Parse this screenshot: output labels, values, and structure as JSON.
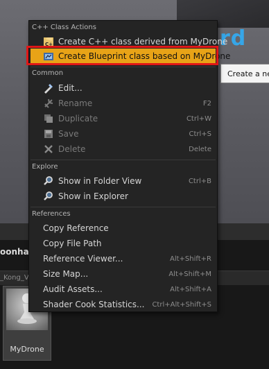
{
  "viewport": {
    "brand_text": "rd",
    "tooltip_text": "Create a new"
  },
  "content_browser": {
    "panel_title": "oonhak",
    "path_text": "_Kong_V",
    "asset_name": "MyDrone"
  },
  "menu": {
    "sections": {
      "cpp": "C++ Class Actions",
      "common": "Common",
      "explore": "Explore",
      "references": "References"
    },
    "cpp_items": [
      {
        "label": "Create C++ class derived from MyDrone",
        "icon": "cpp-class-icon"
      },
      {
        "label": "Create Blueprint class based on MyDrone",
        "icon": "blueprint-class-icon"
      }
    ],
    "common_items": [
      {
        "label": "Edit...",
        "shortcut": "",
        "icon": "edit-icon"
      },
      {
        "label": "Rename",
        "shortcut": "F2",
        "icon": "rename-icon"
      },
      {
        "label": "Duplicate",
        "shortcut": "Ctrl+W",
        "icon": "duplicate-icon"
      },
      {
        "label": "Save",
        "shortcut": "Ctrl+S",
        "icon": "save-icon"
      },
      {
        "label": "Delete",
        "shortcut": "Delete",
        "icon": "delete-icon"
      }
    ],
    "explore_items": [
      {
        "label": "Show in Folder View",
        "shortcut": "Ctrl+B",
        "icon": "search-icon"
      },
      {
        "label": "Show in Explorer",
        "shortcut": "",
        "icon": "search-icon"
      }
    ],
    "reference_items": [
      {
        "label": "Copy Reference",
        "shortcut": ""
      },
      {
        "label": "Copy File Path",
        "shortcut": ""
      },
      {
        "label": "Reference Viewer...",
        "shortcut": "Alt+Shift+R"
      },
      {
        "label": "Size Map...",
        "shortcut": "Alt+Shift+M"
      },
      {
        "label": "Audit Assets...",
        "shortcut": "Alt+Shift+A"
      },
      {
        "label": "Shader Cook Statistics...",
        "shortcut": "Ctrl+Alt+Shift+S"
      }
    ]
  },
  "colors": {
    "highlight": "#e8a317",
    "outline": "#e01717",
    "menu_bg": "#242424"
  }
}
